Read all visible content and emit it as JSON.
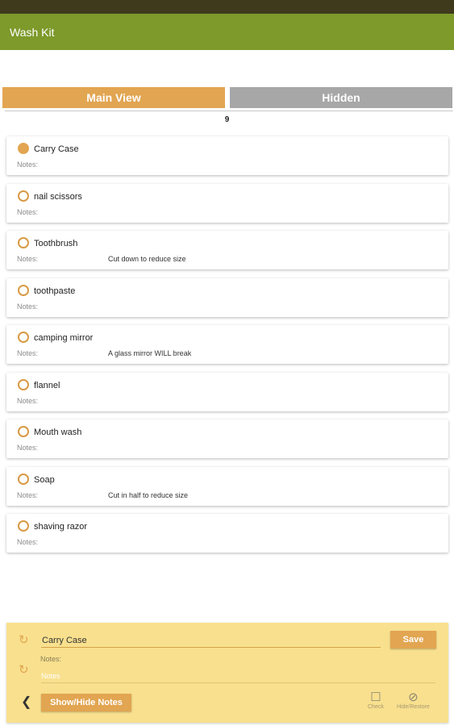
{
  "app_bar": {
    "title": "Wash Kit"
  },
  "tabs": {
    "main": "Main View",
    "hidden": "Hidden"
  },
  "item_count": "9",
  "items": [
    {
      "name": "Carry Case",
      "notes_label": "Notes:",
      "notes": "",
      "checked": true
    },
    {
      "name": "nail scissors",
      "notes_label": "Notes:",
      "notes": "",
      "checked": false
    },
    {
      "name": "Toothbrush",
      "notes_label": "Notes:",
      "notes": "Cut down to reduce size",
      "checked": false
    },
    {
      "name": "toothpaste",
      "notes_label": "Notes:",
      "notes": "",
      "checked": false
    },
    {
      "name": "camping mirror",
      "notes_label": "Notes:",
      "notes": "A glass mirror WILL break",
      "checked": false
    },
    {
      "name": "flannel",
      "notes_label": "Notes:",
      "notes": "",
      "checked": false
    },
    {
      "name": "Mouth wash",
      "notes_label": "Notes:",
      "notes": "",
      "checked": false
    },
    {
      "name": "Soap",
      "notes_label": "Notes:",
      "notes": "Cut in half to reduce size",
      "checked": false
    },
    {
      "name": "shaving razor",
      "notes_label": "Notes:",
      "notes": "",
      "checked": false
    }
  ],
  "editor": {
    "name_value": "Carry Case",
    "save_label": "Save",
    "notes_caption": "Notes:",
    "notes_placeholder": "Notes",
    "show_hide_label": "Show/Hide Notes",
    "check_label": "Check",
    "hide_restore_label": "Hide/Restore"
  },
  "colors": {
    "app_bar": "#7d9a2b",
    "accent": "#e2a551",
    "panel": "#f8e08e",
    "hidden_tab": "#a7a7a7"
  },
  "icons": {
    "reset": "undo-icon",
    "back": "chevron-left-icon",
    "check": "square-icon",
    "hide": "hide-icon"
  }
}
